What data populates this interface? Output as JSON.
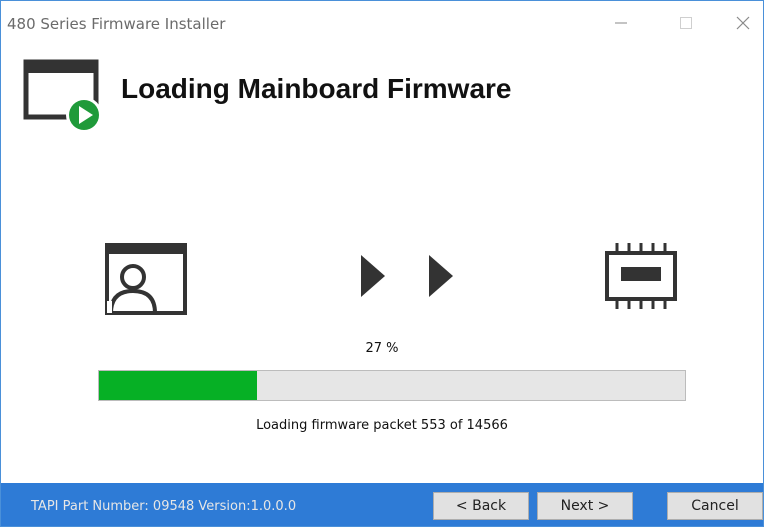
{
  "window": {
    "title": "480 Series Firmware Installer",
    "accent_color": "#2e7bd6",
    "controls": [
      "minimize-icon",
      "maximize-icon",
      "close-icon"
    ]
  },
  "header": {
    "title": "Loading Mainboard Firmware",
    "icon": "window-play-icon"
  },
  "flow": {
    "source_icon": "user-window-icon",
    "arrow_icon": "play-arrow-icon",
    "target_icon": "chip-icon"
  },
  "progress": {
    "percent_label": "27 %",
    "value": 0.27,
    "fill_color": "#06b025",
    "status": "Loading firmware packet 553 of 14566"
  },
  "footer": {
    "part_info": "TAPI Part Number: 09548  Version:1.0.0.0",
    "back_label": "< Back",
    "next_label": "Next >",
    "cancel_label": "Cancel"
  }
}
